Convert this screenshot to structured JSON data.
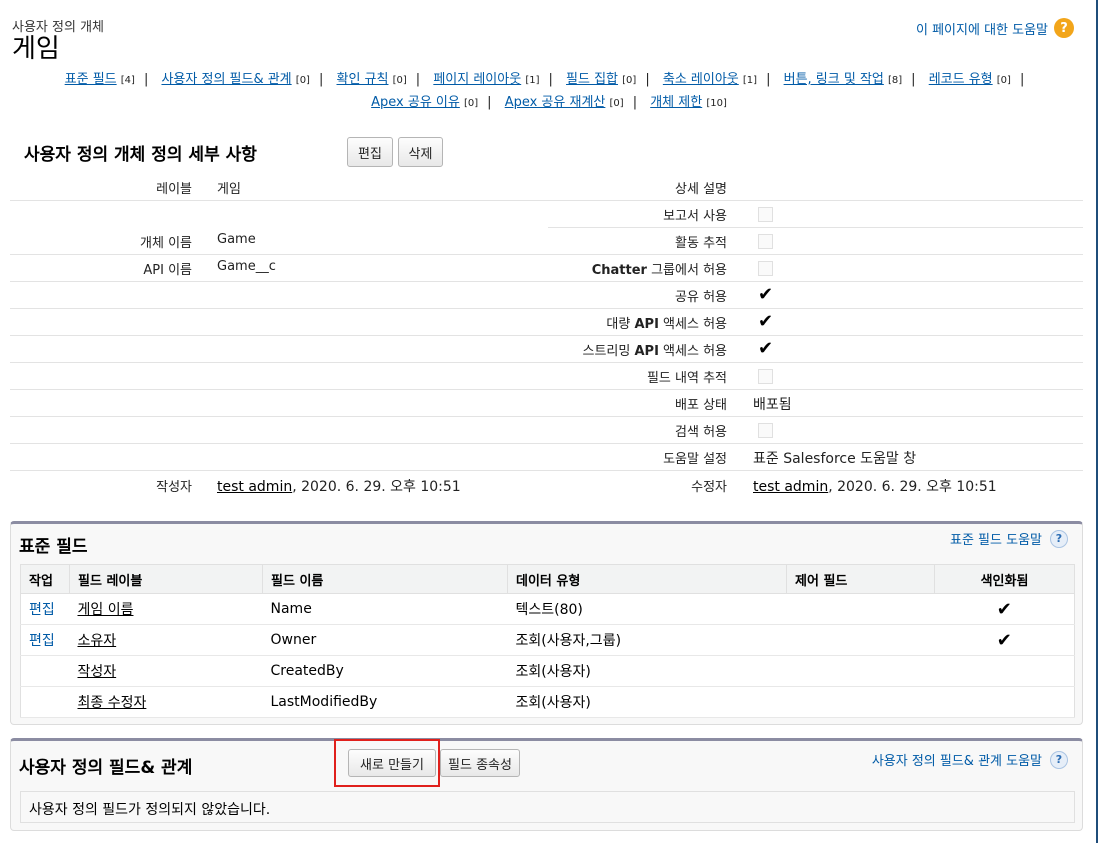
{
  "header": {
    "object_type": "사용자 정의 개체",
    "title": "게임",
    "help_link": "이 페이지에 대한 도움말",
    "help_icon": "question-circle-icon"
  },
  "nav": {
    "row1": [
      {
        "label": "표준 필드",
        "count": "[4]"
      },
      {
        "label": "사용자 정의 필드& 관계",
        "count": "[0]"
      },
      {
        "label": "확인 규칙",
        "count": "[0]"
      },
      {
        "label": "페이지 레이아웃",
        "count": "[1]"
      },
      {
        "label": "필드 집합",
        "count": "[0]"
      },
      {
        "label": "축소 레이아웃",
        "count": "[1]"
      },
      {
        "label": "버튼, 링크 및 작업",
        "count": "[8]"
      },
      {
        "label": "레코드 유형",
        "count": "[0]"
      }
    ],
    "row2": [
      {
        "label": "Apex 공유 이유",
        "count": "[0]"
      },
      {
        "label": "Apex 공유 재계산",
        "count": "[0]"
      },
      {
        "label": "개체 제한",
        "count": "[10]"
      }
    ],
    "separator": "|"
  },
  "detail": {
    "title": "사용자 정의 개체 정의 세부 사항",
    "edit_button": "편집",
    "delete_button": "삭제",
    "left": {
      "label_label": "레이블",
      "label_value": "게임",
      "object_name_label": "개체 이름",
      "object_name_value": "Game",
      "api_name_label": "API 이름",
      "api_name_value": "Game__c",
      "created_by_label": "작성자",
      "created_by_user": "test admin",
      "created_by_date": ", 2020. 6. 29. 오후 10:51"
    },
    "right": {
      "description": "상세 설명",
      "allow_reports": "보고서 사용",
      "track_activities": "활동 추적",
      "allow_chatter_prefix": "Chatter",
      "allow_chatter_suffix": " 그룹에서 허용",
      "allow_sharing": "공유 허용",
      "bulk_api_prefix": "대량 ",
      "bulk_api_bold": "API",
      "bulk_api_suffix": " 액세스 허용",
      "streaming_api_prefix": "스트리밍 ",
      "streaming_api_bold": "API",
      "streaming_api_suffix": " 액세스 허용",
      "field_history": "필드 내역 추적",
      "deploy_status_label": "배포 상태",
      "deploy_status_value": "배포됨",
      "allow_search": "검색 허용",
      "help_setting_label": "도움말 설정",
      "help_setting_value": "표준 Salesforce 도움말 창",
      "modified_by_label": "수정자",
      "modified_by_user": "test admin",
      "modified_by_date": ", 2020. 6. 29. 오후 10:51"
    },
    "checks": {
      "allow_reports": false,
      "track_activities": false,
      "allow_chatter": false,
      "allow_sharing": true,
      "bulk_api": true,
      "streaming_api": true,
      "field_history": false,
      "allow_search": false
    },
    "checkmark_glyph": "✔"
  },
  "standard_fields": {
    "title": "표준 필드",
    "help_link": "표준 필드 도움말",
    "columns": [
      "작업",
      "필드 레이블",
      "필드 이름",
      "데이터 유형",
      "제어 필드",
      "색인화됨"
    ],
    "rows": [
      {
        "action": "편집",
        "label": "게임 이름",
        "name": "Name",
        "type": "텍스트(80)",
        "control": "",
        "indexed": true
      },
      {
        "action": "편집",
        "label": "소유자",
        "name": "Owner",
        "type": "조회(사용자,그룹)",
        "control": "",
        "indexed": true
      },
      {
        "action": "",
        "label": "작성자",
        "name": "CreatedBy",
        "type": "조회(사용자)",
        "control": "",
        "indexed": false
      },
      {
        "action": "",
        "label": "최종 수정자",
        "name": "LastModifiedBy",
        "type": "조회(사용자)",
        "control": "",
        "indexed": false
      }
    ]
  },
  "custom_fields": {
    "title": "사용자 정의 필드& 관계",
    "new_button": "새로 만들기",
    "deps_button": "필드 종속성",
    "help_link": "사용자 정의 필드& 관계 도움말",
    "empty_message": "사용자 정의 필드가 정의되지 않았습니다."
  },
  "colors": {
    "link": "#015ba7",
    "help_orange": "#f2a51a",
    "panel_border": "#8b8ca2",
    "highlight": "#e0201c"
  }
}
